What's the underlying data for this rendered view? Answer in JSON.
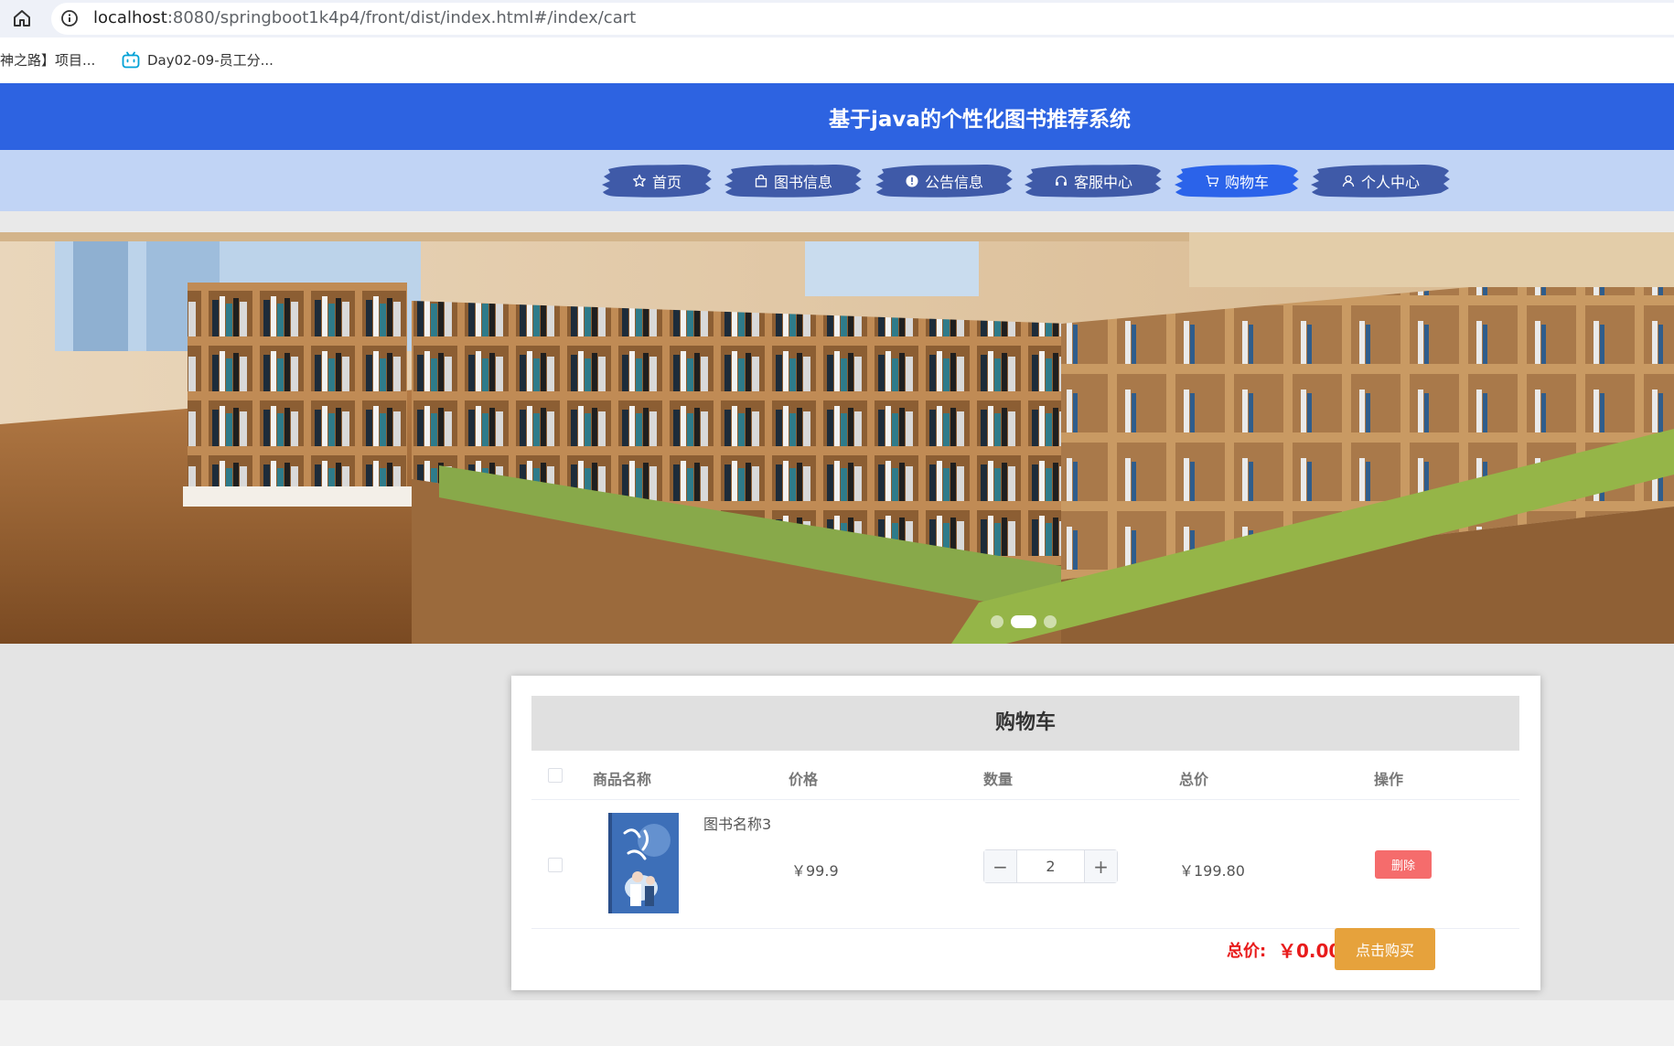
{
  "browser": {
    "url_host": "localhost",
    "url_path": ":8080/springboot1k4p4/front/dist/index.html#/index/cart",
    "bookmarks": [
      {
        "label": "神之路】项目..."
      },
      {
        "label": "Day02-09-员工分..."
      }
    ]
  },
  "header": {
    "title": "基于java的个性化图书推荐系统"
  },
  "nav": {
    "items": [
      {
        "label": "首页",
        "icon": "star-icon",
        "active": false
      },
      {
        "label": "图书信息",
        "icon": "bag-icon",
        "active": false
      },
      {
        "label": "公告信息",
        "icon": "info-icon",
        "active": false
      },
      {
        "label": "客服中心",
        "icon": "headset-icon",
        "active": false
      },
      {
        "label": "购物车",
        "icon": "cart-icon",
        "active": true
      },
      {
        "label": "个人中心",
        "icon": "user-icon",
        "active": false
      }
    ]
  },
  "carousel": {
    "slide_count": 3,
    "active_index": 1
  },
  "cart": {
    "title": "购物车",
    "columns": {
      "name": "商品名称",
      "price": "价格",
      "quantity": "数量",
      "total": "总价",
      "action": "操作"
    },
    "items": [
      {
        "name": "图书名称3",
        "price": "￥99.9",
        "quantity": "2",
        "total": "￥199.80",
        "delete_label": "删除"
      }
    ],
    "summary": {
      "total_label": "总价:",
      "total_amount": "￥0.00",
      "buy_label": "点击购买"
    }
  },
  "colors": {
    "header": "#2d63e1",
    "nav_bg": "#c1d4f5",
    "nav_brush": "#3f5aa8",
    "nav_brush_active": "#2b63ea",
    "delete": "#f56c6c",
    "buy": "#e6a23c",
    "total": "#e81b1b"
  }
}
